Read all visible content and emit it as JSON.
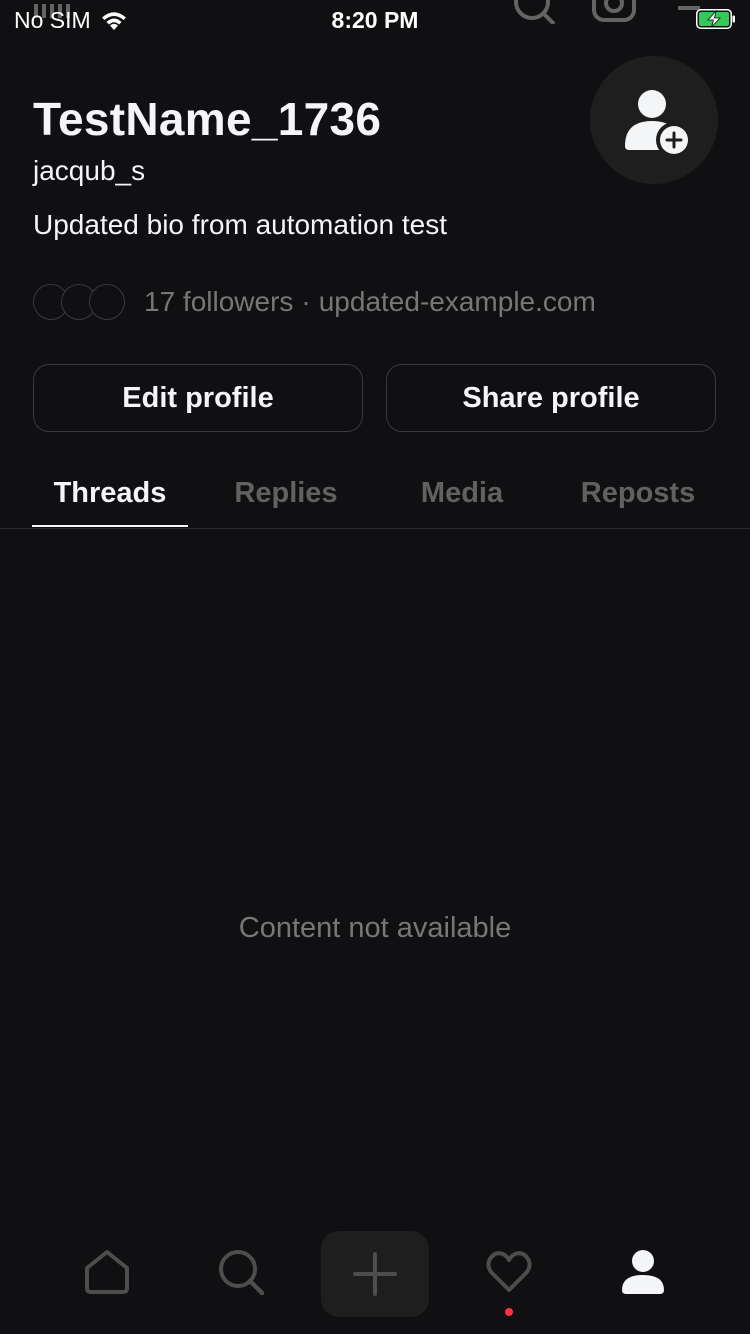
{
  "status_bar": {
    "carrier": "No SIM",
    "time": "8:20 PM"
  },
  "profile": {
    "name": "TestName_1736",
    "handle": "jacqub_s",
    "bio": "Updated bio from automation test",
    "followers_text": "17 followers",
    "separator": "·",
    "link": "updated-example.com"
  },
  "actions": {
    "edit_label": "Edit profile",
    "share_label": "Share profile"
  },
  "tabs": [
    {
      "label": "Threads",
      "active": true
    },
    {
      "label": "Replies",
      "active": false
    },
    {
      "label": "Media",
      "active": false
    },
    {
      "label": "Reposts",
      "active": false
    }
  ],
  "content": {
    "empty_message": "Content not available"
  },
  "bottom_nav": {
    "items": [
      "home-icon",
      "search-icon",
      "compose-icon",
      "activity-heart-icon",
      "profile-icon"
    ],
    "active": "profile-icon"
  },
  "colors": {
    "background": "#101012",
    "text_primary": "#f3f5f7",
    "text_secondary": "#777777",
    "notification_dot": "#ff3040",
    "battery_charge": "#34c759"
  }
}
